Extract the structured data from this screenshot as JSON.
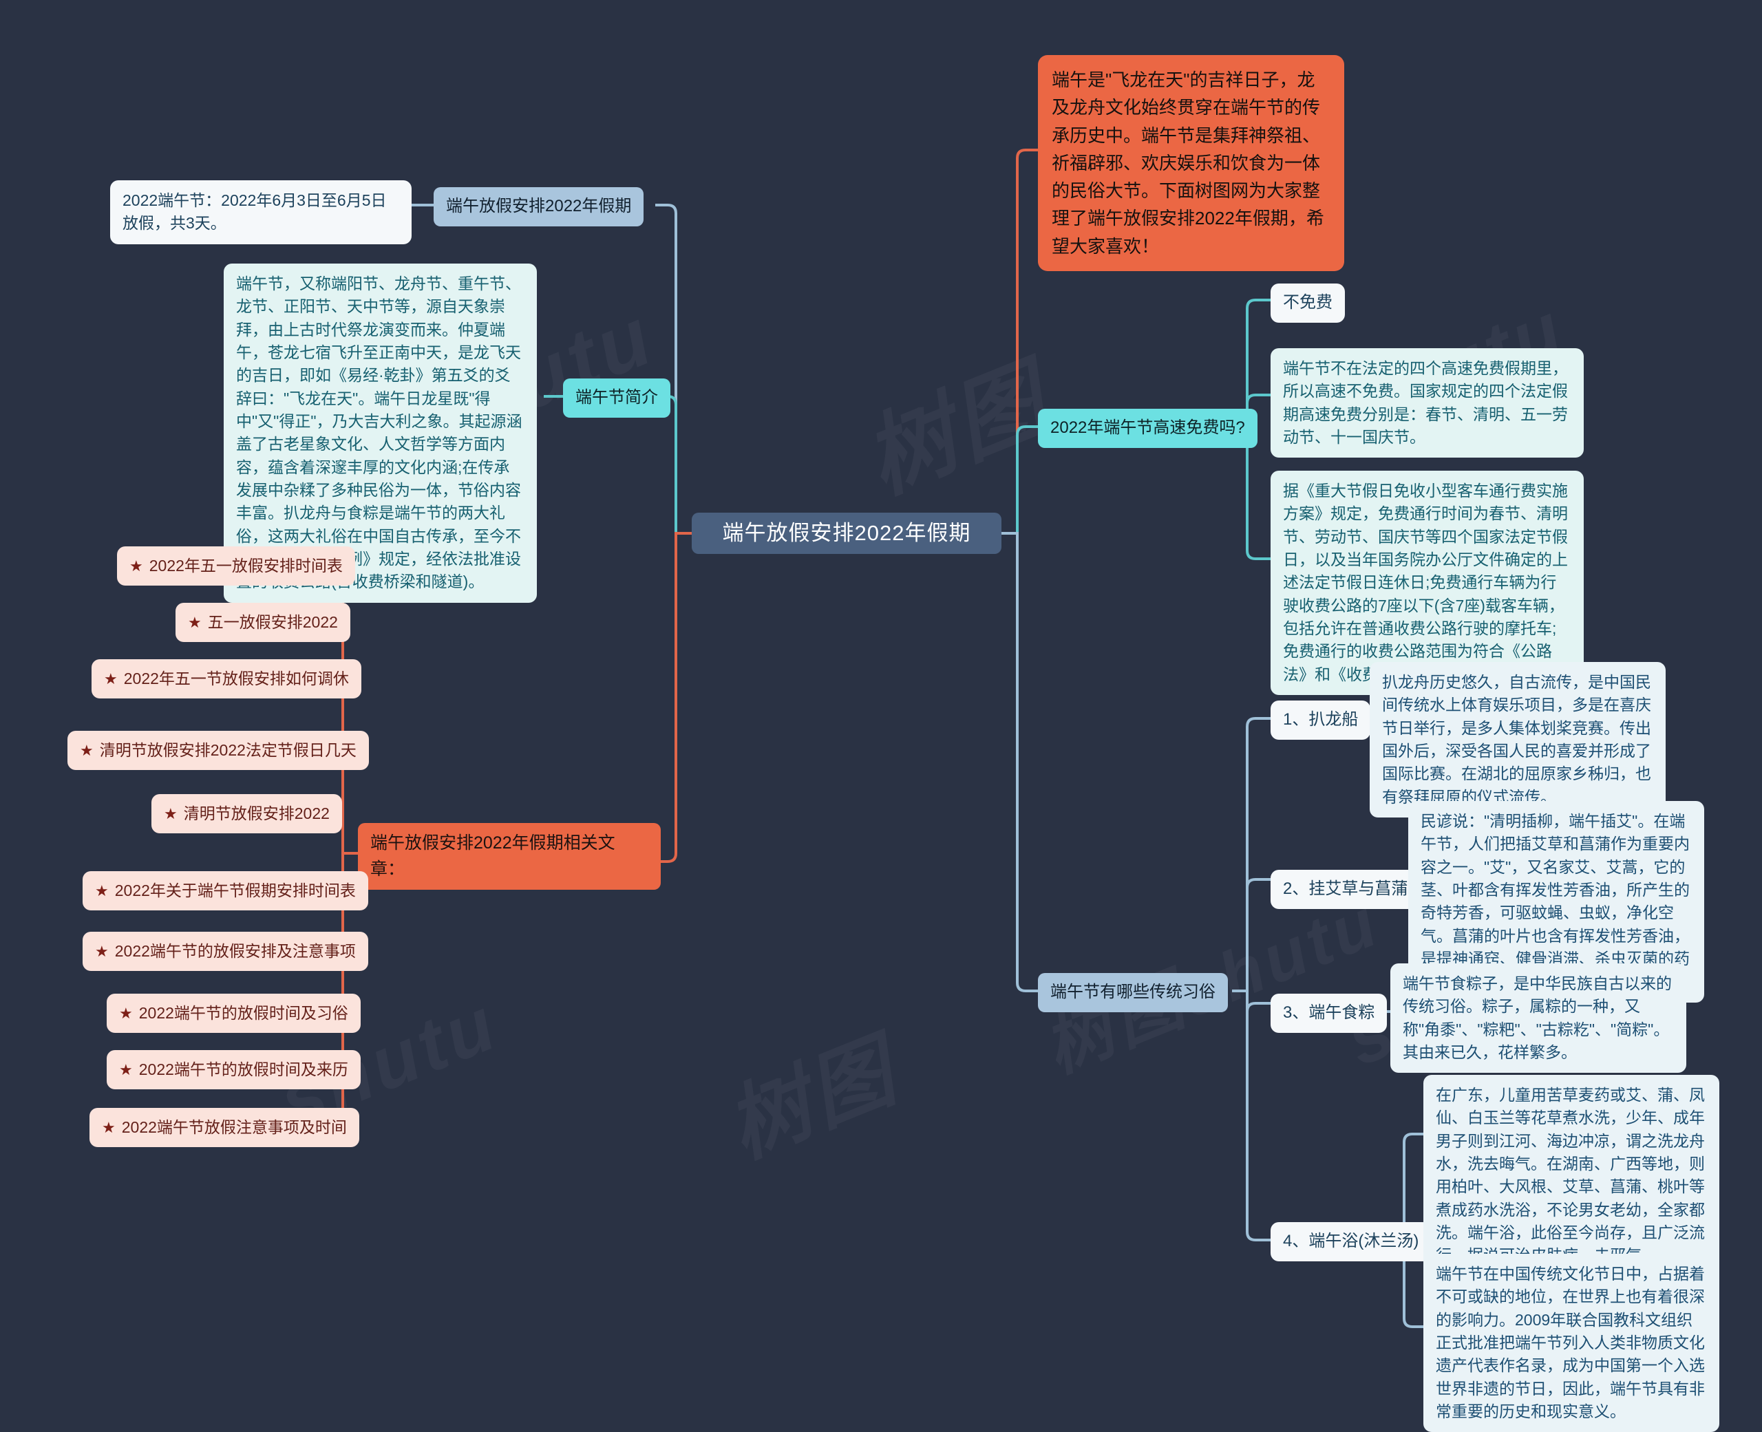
{
  "root": {
    "label": "端午放假安排2022年假期"
  },
  "intro_card": {
    "text": "端午是\"飞龙在天\"的吉祥日子，龙及龙舟文化始终贯穿在端午节的传承历史中。端午节是集拜神祭祖、祈福辟邪、欢庆娱乐和饮食为一体的民俗大节。下面树图网为大家整理了端午放假安排2022年假期，希望大家喜欢！"
  },
  "left_branches": {
    "holiday": {
      "label": "端午放假安排2022年假期",
      "detail": "2022端午节：2022年6月3日至6月5日放假，共3天。"
    },
    "intro": {
      "label": "端午节简介",
      "detail": "端午节，又称端阳节、龙舟节、重午节、龙节、正阳节、天中节等，源自天象崇拜，由上古时代祭龙演变而来。仲夏端午，苍龙七宿飞升至正南中天，是龙飞天的吉日，即如《易经·乾卦》第五爻的爻辞曰：\"飞龙在天\"。端午日龙星既\"得中\"又\"得正\"，乃大吉大利之象。其起源涵盖了古老星象文化、人文哲学等方面内容，蕴含着深邃丰厚的文化内涵;在传承发展中杂糅了多种民俗为一体，节俗内容丰富。扒龙舟与食粽是端午节的两大礼俗，这两大礼俗在中国自古传承，至今不辍。公路管理条例》规定，经依法批准设置的收费公路(含收费桥梁和隧道)。"
    },
    "articles": {
      "label": "端午放假安排2022年假期相关文章：",
      "items": [
        "2022年五一放假安排时间表",
        "五一放假安排2022",
        "2022年五一节放假安排如何调休",
        "清明节放假安排2022法定节假日几天",
        "清明节放假安排2022",
        "2022年关于端午节假期安排时间表",
        "2022端午节的放假安排及注意事项",
        "2022端午节的放假时间及习俗",
        "2022端午节的放假时间及来历",
        "2022端午节放假注意事项及时间"
      ],
      "bullet": "★"
    }
  },
  "right_branches": {
    "freeway": {
      "label": "2022年端午节高速免费吗?",
      "answer": "不免费",
      "explain": "端午节不在法定的四个高速免费假期里，所以高速不免费。国家规定的四个法定假期高速免费分别是：春节、清明、五一劳动节、十一国庆节。",
      "regulation": "据《重大节假日免收小型客车通行费实施方案》规定，免费通行时间为春节、清明节、劳动节、国庆节等四个国家法定节假日，以及当年国务院办公厅文件确定的上述法定节假日连休日;免费通行车辆为行驶收费公路的7座以下(含7座)载客车辆，包括允许在普通收费公路行驶的摩托车;免费通行的收费公路范围为符合《公路法》和《收费"
    },
    "customs": {
      "label": "端午节有哪些传统习俗",
      "items": [
        {
          "label": "1、扒龙船",
          "detail": "扒龙舟历史悠久，自古流传，是中国民间传统水上体育娱乐项目，多是在喜庆节日举行，是多人集体划桨竞赛。传出国外后，深受各国人民的喜爱并形成了国际比赛。在湖北的屈原家乡秭归，也有祭拜屈原的仪式流传。"
        },
        {
          "label": "2、挂艾草与菖蒲",
          "detail": "民谚说：\"清明插柳，端午插艾\"。在端午节，人们把插艾草和菖蒲作为重要内容之一。\"艾\"，又名家艾、艾蒿，它的茎、叶都含有挥发性芳香油，所产生的奇特芳香，可驱蚊蝇、虫蚁，净化空气。菖蒲的叶片也含有挥发性芳香油，是提神通窍、健骨消滞、杀虫灭菌的药物。"
        },
        {
          "label": "3、端午食粽",
          "detail": "端午节食粽子，是中华民族自古以来的传统习俗。粽子，属粽的一种，又称\"角黍\"、\"粽粑\"、\"古粽籺\"、\"简粽\"。其由来已久，花样繁多。"
        },
        {
          "label": "4、端午浴(沐兰汤)",
          "detail": "在广东，儿童用苦草麦药或艾、蒲、凤仙、白玉兰等花草煮水洗，少年、成年男子则到江河、海边冲凉，谓之洗龙舟水，洗去晦气。在湖南、广西等地，则用柏叶、大风根、艾草、菖蒲、桃叶等煮成药水洗浴，不论男女老幼，全家都洗。端午浴，此俗至今尚存，且广泛流行，据说可治皮肤病、去邪气。"
        }
      ],
      "closing": "端午节在中国传统文化节日中，占据着不可或缺的地位，在世界上也有着很深的影响力。2009年联合国教科文组织正式批准把端午节列入人类非物质文化遗产代表作名录，成为中国第一个入选世界非遗的节日，因此，端午节具有非常重要的历史和现实意义。"
    }
  },
  "theme": {
    "background": "#2a3244",
    "root_bg": "#4a607f",
    "blue_bg": "#a9c5dd",
    "cyan_bg": "#6ce0e2",
    "orange_bg": "#eb6744",
    "pink_bg": "#fbe3dc",
    "white_bg": "#f5f8fa",
    "link_blue": "#9fc0d8",
    "link_cyan": "#5cc8cc",
    "link_orange": "#e2664a"
  },
  "watermarks": [
    "树图shutu",
    "shutu",
    "树图",
    "shutu"
  ]
}
